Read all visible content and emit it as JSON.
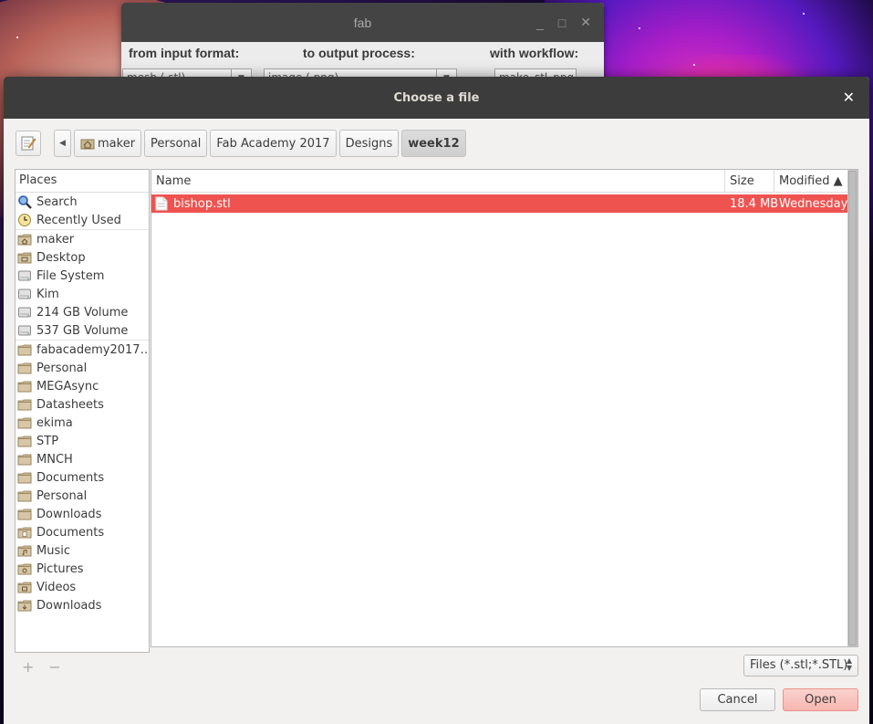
{
  "background_window": {
    "title": "fab",
    "labels": [
      "from input format:",
      "to output process:",
      "with workflow:"
    ],
    "combos": [
      "mesh (.stl)",
      "image (.png)",
      "make_stl_png"
    ],
    "controls": [
      "_",
      "□",
      "✕"
    ]
  },
  "dialog": {
    "title": "Choose a file",
    "close_glyph": "✕"
  },
  "pathbar": {
    "back_glyph": "◀",
    "crumbs": [
      "maker",
      "Personal",
      "Fab Academy 2017",
      "Designs",
      "week12"
    ]
  },
  "places": {
    "header": "Places",
    "items": [
      {
        "label": "Search",
        "icon": "search-icon"
      },
      {
        "label": "Recently Used",
        "icon": "recent-icon"
      },
      {
        "label": "maker",
        "icon": "home-folder-icon"
      },
      {
        "label": "Desktop",
        "icon": "desktop-folder-icon"
      },
      {
        "label": "File System",
        "icon": "drive-icon"
      },
      {
        "label": "Kim",
        "icon": "drive-icon"
      },
      {
        "label": "214 GB Volume",
        "icon": "drive-icon"
      },
      {
        "label": "537 GB Volume",
        "icon": "drive-icon"
      },
      {
        "label": "fabacademy2017…",
        "icon": "folder-icon"
      },
      {
        "label": "Personal",
        "icon": "folder-icon"
      },
      {
        "label": "MEGAsync",
        "icon": "folder-icon"
      },
      {
        "label": "Datasheets",
        "icon": "folder-icon"
      },
      {
        "label": "ekima",
        "icon": "folder-icon"
      },
      {
        "label": "STP",
        "icon": "folder-icon"
      },
      {
        "label": "MNCH",
        "icon": "folder-icon"
      },
      {
        "label": "Documents",
        "icon": "folder-icon"
      },
      {
        "label": "Personal",
        "icon": "folder-icon"
      },
      {
        "label": "Downloads",
        "icon": "folder-icon"
      },
      {
        "label": "Documents",
        "icon": "documents-folder-icon"
      },
      {
        "label": "Music",
        "icon": "music-folder-icon"
      },
      {
        "label": "Pictures",
        "icon": "pictures-folder-icon"
      },
      {
        "label": "Videos",
        "icon": "videos-folder-icon"
      },
      {
        "label": "Downloads",
        "icon": "downloads-folder-icon"
      }
    ],
    "add_glyph": "+",
    "remove_glyph": "−"
  },
  "files": {
    "columns": {
      "name": "Name",
      "size": "Size",
      "modified": "Modified ▲"
    },
    "rows": [
      {
        "name": "bishop.stl",
        "size": "18.4 MB",
        "modified": "Wednesday",
        "selected": true
      }
    ]
  },
  "filter": {
    "value": "Files (*.stl;*.STL)"
  },
  "buttons": {
    "cancel": "Cancel",
    "open": "Open"
  },
  "colors": {
    "selection": "#ef5350",
    "titlebar": "#3c3c3c",
    "open_button": "#f6b6b0"
  }
}
